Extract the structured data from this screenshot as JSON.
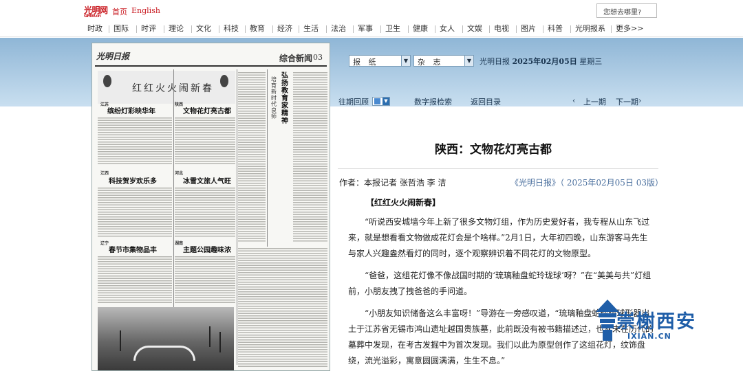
{
  "topbar": {
    "logo": "光明网",
    "logo_sub": "GMW.cn",
    "links": [
      "首页",
      "English"
    ],
    "search_placeholder": "您想去哪里?"
  },
  "nav": [
    "时政",
    "国际",
    "时评",
    "理论",
    "文化",
    "科技",
    "教育",
    "经济",
    "生活",
    "法治",
    "军事",
    "卫生",
    "健康",
    "女人",
    "文娱",
    "电视",
    "图片",
    "科普",
    "光明报系",
    "更多>>"
  ],
  "controls": {
    "paper_select": "报 纸",
    "magazine_select": "杂 志",
    "paper_name": "光明日报",
    "date": "2025年02月05日",
    "weekday": "星期三",
    "past_review": "往期回顾",
    "digital_search": "数字报检索",
    "back_to_index": "返回目录",
    "prev_issue": "上一期",
    "next_issue": "下一期",
    "prev_arrow": "‹",
    "next_arrow": "›"
  },
  "newspaper": {
    "masthead": "光明日报",
    "section": "综合新闻",
    "page_no": "03",
    "banner": "红红火火闹新春",
    "vertical_head": "弘扬教育家精神",
    "vertical_head2": "培育新时代良师",
    "headlines": [
      {
        "region": "江苏",
        "title": "缤纷灯彩映华年"
      },
      {
        "region": "陕西",
        "title": "文物花灯亮古都"
      },
      {
        "region": "江西",
        "title": "科技贺岁欢乐多"
      },
      {
        "region": "河北",
        "title": "冰雪文旅人气旺"
      },
      {
        "region": "辽宁",
        "title": "春节市集物品丰"
      },
      {
        "region": "湖南",
        "title": "主题公园趣味浓"
      }
    ]
  },
  "article": {
    "title": "陕西：文物花灯亮古都",
    "author": "作者：本报记者 张哲浩 李 洁",
    "source": "《光明日报》（ 2025年02月05日 03版）",
    "subtitle": "【红红火火闹新春】",
    "paragraphs": [
      "“听说西安城墙今年上新了很多文物灯组，作为历史爱好者，我专程从山东飞过来，就是想看看文物做成花灯会是个啥样。”2月1日，大年初四晚，山东游客马先生与家人兴趣盎然看灯的同时，逐个观察辨识着不同花灯的文物原型。",
      "“爸爸，这组花灯像不像战国时期的‘琉璃釉盘蛇玲珑球’呀？”在“美美与共”灯组前，小朋友拽了拽爸爸的手问道。",
      "“小朋友知识储备这么丰富呀！”导游在一旁感叹道，“琉璃釉盘蛇玲珑球形器出土于江苏省无锡市鸿山遗址越国贵族墓，此前既没有被书籍描述过，也从未在历代的墓葬中发现，在考古发掘中为首次发现。我们以此为原型创作了这组花灯，纹饰盘绕，流光溢彩，寓意圆圆满满，生生不息。”"
    ]
  },
  "watermark": {
    "text": "崇榭西安",
    "url": "IXIAN.CN"
  }
}
